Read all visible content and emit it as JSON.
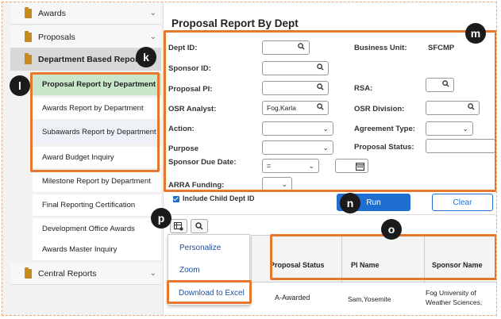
{
  "sidebar": {
    "awards": "Awards",
    "proposals": "Proposals",
    "department_reports": "Department Based Reports",
    "items": [
      "Proposal Report by Department",
      "Awards Report by Department",
      "Subawards Report by Department",
      "Award Budget Inquiry",
      "Milestone Report by Department",
      "Final Reporting Certification",
      "Development Office Awards",
      "Awards Master Inquiry"
    ],
    "central_reports": "Central Reports"
  },
  "page": {
    "title": "Proposal Report By Dept"
  },
  "form": {
    "dept_id_label": "Dept ID:",
    "sponsor_id_label": "Sponsor ID:",
    "proposal_pi_label": "Proposal PI:",
    "osr_analyst_label": "OSR Analyst:",
    "osr_analyst_value": "Fog,Karla",
    "action_label": "Action:",
    "purpose_label": "Purpose",
    "sponsor_due_label": "Sponsor Due Date:",
    "sponsor_due_op": "=",
    "arra_label": "ARRA Funding:",
    "business_unit_label": "Business Unit:",
    "business_unit_value": "SFCMP",
    "rsa_label": "RSA:",
    "osr_division_label": "OSR Division:",
    "agreement_type_label": "Agreement Type:",
    "proposal_status_label": "Proposal Status:",
    "include_child_label": "Include Child Dept ID",
    "run_label": "Run",
    "clear_label": "Clear"
  },
  "menu": {
    "personalize": "Personalize",
    "zoom": "Zoom",
    "download": "Download to Excel"
  },
  "grid": {
    "headers": [
      "Proposal Status",
      "PI Name",
      "Sponsor Name"
    ],
    "row": [
      "A-Awarded",
      "Sam,Yosemite",
      "Fog University of",
      "Weather Sciences,"
    ]
  },
  "callouts": {
    "k": "k",
    "l": "l",
    "m": "m",
    "n": "n",
    "o": "o",
    "p": "p"
  },
  "colors": {
    "accent": "#e5782e",
    "primary": "#1f6fd1",
    "active_item": "#c8e6c9"
  }
}
